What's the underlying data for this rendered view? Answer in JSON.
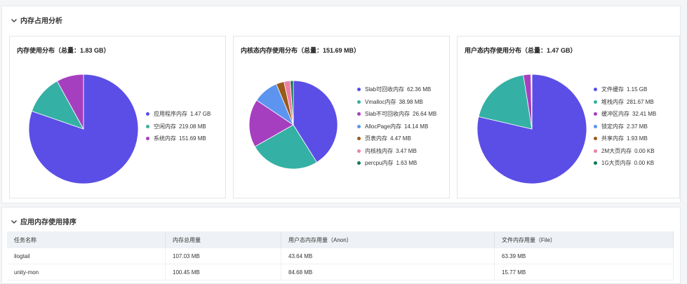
{
  "memory_section": {
    "title": "内存占用分析"
  },
  "cards": [
    {
      "title": "内存使用分布（总量：1.83 GB）",
      "items": [
        {
          "label": "应用程序内存",
          "value": "1.47 GB",
          "share": 0.803,
          "color": "#5b4ee6"
        },
        {
          "label": "空闲内存",
          "value": "219.08 MB",
          "share": 0.117,
          "color": "#35b0a4"
        },
        {
          "label": "系统内存",
          "value": "151.69 MB",
          "share": 0.08,
          "color": "#a63fbf"
        }
      ]
    },
    {
      "title": "内核态内存使用分布（总量：151.69 MB）",
      "items": [
        {
          "label": "Slab可回收内存",
          "value": "62.36 MB",
          "share": 0.411,
          "color": "#5b4ee6"
        },
        {
          "label": "Vmalloc内存",
          "value": "38.98 MB",
          "share": 0.257,
          "color": "#35b0a4"
        },
        {
          "label": "Slab不可回收内存",
          "value": "26.64 MB",
          "share": 0.176,
          "color": "#a63fbf"
        },
        {
          "label": "AllocPage内存",
          "value": "14.14 MB",
          "share": 0.093,
          "color": "#5c94f0"
        },
        {
          "label": "页表内存",
          "value": "4.47 MB",
          "share": 0.029,
          "color": "#9a5a1a"
        },
        {
          "label": "内核栈内存",
          "value": "3.47 MB",
          "share": 0.023,
          "color": "#ef7eaa"
        },
        {
          "label": "percpu内存",
          "value": "1.63 MB",
          "share": 0.011,
          "color": "#0f7a55"
        }
      ]
    },
    {
      "title": "用户态内存使用分布（总量：1.47 GB）",
      "items": [
        {
          "label": "文件缓存",
          "value": "1.15 GB",
          "share": 0.78,
          "color": "#5b4ee6"
        },
        {
          "label": "堆栈内存",
          "value": "281.67 MB",
          "share": 0.187,
          "color": "#35b0a4"
        },
        {
          "label": "缓冲区内存",
          "value": "32.41 MB",
          "share": 0.022,
          "color": "#a63fbf"
        },
        {
          "label": "锁定内存",
          "value": "2.37 MB",
          "share": 0.0016,
          "color": "#5c94f0"
        },
        {
          "label": "共享内存",
          "value": "1.93 MB",
          "share": 0.0013,
          "color": "#9a5a1a"
        },
        {
          "label": "2M大页内存",
          "value": "0.00 KB",
          "share": 0,
          "color": "#ef7eaa"
        },
        {
          "label": "1G大页内存",
          "value": "0.00 KB",
          "share": 0,
          "color": "#0f7a55"
        }
      ]
    }
  ],
  "app_section": {
    "title": "应用内存使用排序"
  },
  "table": {
    "columns": [
      "任务名称",
      "内存总用量",
      "用户态内存用量（Anon）",
      "文件内存用量（File）"
    ],
    "rows": [
      [
        "ilogtail",
        "107.03 MB",
        "43.64 MB",
        "63.39 MB"
      ],
      [
        "unity-mon",
        "100.45 MB",
        "84.68 MB",
        "15.77 MB"
      ]
    ]
  }
}
